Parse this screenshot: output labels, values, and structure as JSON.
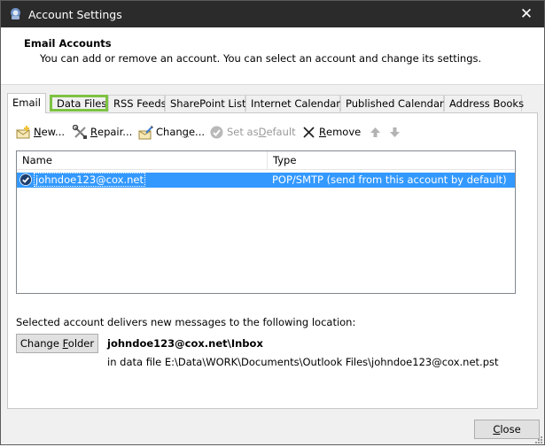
{
  "window": {
    "title": "Account Settings",
    "close_glyph": "✕",
    "icons": {
      "app": "outlook-account-icon",
      "close": "close-icon"
    }
  },
  "header": {
    "title": "Email Accounts",
    "description": "You can add or remove an account. You can select an account and change its settings."
  },
  "tabs": [
    {
      "label": "Email",
      "active": true
    },
    {
      "label": "Data Files",
      "highlighted": true
    },
    {
      "label": "RSS Feeds"
    },
    {
      "label": "SharePoint Lists"
    },
    {
      "label": "Internet Calendars"
    },
    {
      "label": "Published Calendars"
    },
    {
      "label": "Address Books"
    }
  ],
  "toolbar": {
    "new": {
      "pre": "",
      "key": "N",
      "post": "ew..."
    },
    "repair": {
      "pre": "",
      "key": "R",
      "post": "epair..."
    },
    "change": {
      "pre": "Chan",
      "key": "g",
      "post": "e..."
    },
    "set_default": {
      "pre": "Set as ",
      "key": "D",
      "post": "efault"
    },
    "remove": {
      "pre": "",
      "key": "R",
      "post": "emove"
    },
    "icons": [
      "new-mail-icon",
      "repair-tools-icon",
      "change-settings-icon",
      "check-circle-icon",
      "remove-x-icon",
      "arrow-up-icon",
      "arrow-down-icon"
    ]
  },
  "accounts_list": {
    "columns": [
      "Name",
      "Type"
    ],
    "rows": [
      {
        "name": "johndoe123@cox.net",
        "type": "POP/SMTP (send from this account by default)",
        "selected": true
      }
    ],
    "colors": {
      "selection": "#3399ff"
    }
  },
  "location": {
    "label": "Selected account delivers new messages to the following location:",
    "change_folder": {
      "pre": "Change ",
      "key": "F",
      "post": "older"
    },
    "path": "johndoe123@cox.net\\Inbox",
    "file": "in data file E:\\Data\\WORK\\Documents\\Outlook Files\\johndoe123@cox.net.pst"
  },
  "footer": {
    "close": {
      "pre": "",
      "key": "C",
      "post": "lose"
    }
  },
  "colors": {
    "highlight_outline": "#7dc242",
    "titlebar": "#2b2b2b"
  }
}
